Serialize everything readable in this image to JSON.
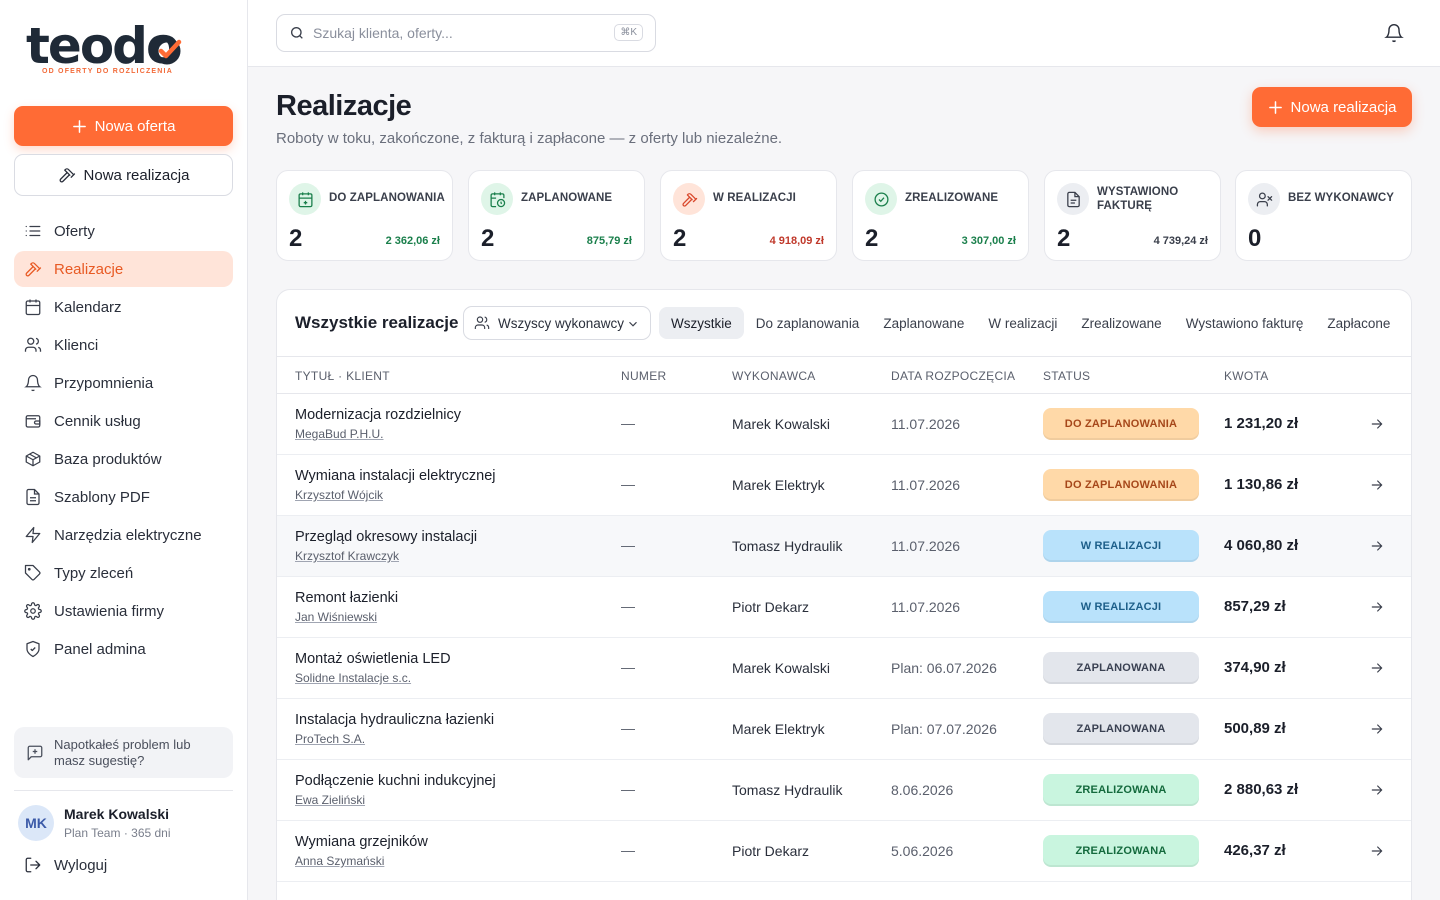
{
  "brand": {
    "name": "teodo",
    "tagline": "OD OFERTY DO ROZLICZENIA",
    "accent": "#ff6b35"
  },
  "sidebar": {
    "new_offer_label": "Nowa oferta",
    "new_realization_label": "Nowa realizacja",
    "items": [
      {
        "label": "Oferty",
        "icon": "list-icon"
      },
      {
        "label": "Realizacje",
        "icon": "hammer-icon",
        "active": true
      },
      {
        "label": "Kalendarz",
        "icon": "calendar-icon"
      },
      {
        "label": "Klienci",
        "icon": "users-icon"
      },
      {
        "label": "Przypomnienia",
        "icon": "bell-icon"
      },
      {
        "label": "Cennik usług",
        "icon": "wallet-icon"
      },
      {
        "label": "Baza produktów",
        "icon": "box-icon"
      },
      {
        "label": "Szablony PDF",
        "icon": "file-icon"
      },
      {
        "label": "Narzędzia elektryczne",
        "icon": "zap-icon"
      },
      {
        "label": "Typy zleceń",
        "icon": "tag-icon"
      },
      {
        "label": "Ustawienia firmy",
        "icon": "gear-icon"
      },
      {
        "label": "Panel admina",
        "icon": "shield-icon"
      }
    ],
    "feedback_label": "Napotkałeś problem lub masz sugestię?",
    "user": {
      "initials": "MK",
      "name": "Marek Kowalski",
      "plan": "Plan Team · 365 dni"
    },
    "logout_label": "Wyloguj"
  },
  "topbar": {
    "search_placeholder": "Szukaj klienta, oferty...",
    "shortcut": "⌘K"
  },
  "page": {
    "title": "Realizacje",
    "subtitle": "Roboty w toku, zakończone, z fakturą i zapłacone — z oferty lub niezależne.",
    "new_button": "Nowa realizacja"
  },
  "stats": [
    {
      "label": "DO ZAPLANOWANIA",
      "count": "2",
      "amount": "2 362,06 zł",
      "color": "#1a7f4b",
      "icon": "calendar-plus-icon"
    },
    {
      "label": "ZAPLANOWANE",
      "count": "2",
      "amount": "875,79 zł",
      "color": "#1a7f4b",
      "icon": "calendar-clock-icon"
    },
    {
      "label": "W REALIZACJI",
      "count": "2",
      "amount": "4 918,09 zł",
      "color": "#c0392b",
      "icon": "hammer-icon"
    },
    {
      "label": "ZREALIZOWANE",
      "count": "2",
      "amount": "3 307,00 zł",
      "color": "#1a7f4b",
      "icon": "check-circle-icon"
    },
    {
      "label": "WYSTAWIONO FAKTURĘ",
      "count": "2",
      "amount": "4 739,24 zł",
      "color": "#3a3f4b",
      "icon": "invoice-icon"
    },
    {
      "label": "BEZ WYKONAWCY",
      "count": "0",
      "amount": "",
      "color": "#3a3f4b",
      "icon": "user-x-icon"
    }
  ],
  "table": {
    "title": "Wszystkie realizacje",
    "executor_filter": "Wszyscy wykonawcy",
    "tabs": [
      "Wszystkie",
      "Do zaplanowania",
      "Zaplanowane",
      "W realizacji",
      "Zrealizowane",
      "Wystawiono fakturę",
      "Zapłacone"
    ],
    "columns": {
      "title": "TYTUŁ · KLIENT",
      "number": "NUMER",
      "executor": "WYKONAWCA",
      "start": "DATA ROZPOCZĘCIA",
      "status": "STATUS",
      "amount": "KWOTA"
    },
    "rows": [
      {
        "title": "Modernizacja rozdzielnicy",
        "client": "MegaBud P.H.U.",
        "number": "—",
        "executor": "Marek Kowalski",
        "date": "11.07.2026",
        "status": "DO ZAPLANOWANIA",
        "status_type": "plan",
        "amount": "1 231,20 zł"
      },
      {
        "title": "Wymiana instalacji elektrycznej",
        "client": "Krzysztof Wójcik",
        "number": "—",
        "executor": "Marek Elektryk",
        "date": "11.07.2026",
        "status": "DO ZAPLANOWANIA",
        "status_type": "plan",
        "amount": "1 130,86 zł"
      },
      {
        "title": "Przegląd okresowy instalacji",
        "client": "Krzysztof Krawczyk",
        "number": "—",
        "executor": "Tomasz Hydraulik",
        "date": "11.07.2026",
        "status": "W REALIZACJI",
        "status_type": "real",
        "amount": "4 060,80 zł",
        "hover": true
      },
      {
        "title": "Remont łazienki",
        "client": "Jan Wiśniewski",
        "number": "—",
        "executor": "Piotr Dekarz",
        "date": "11.07.2026",
        "status": "W REALIZACJI",
        "status_type": "real",
        "amount": "857,29 zł"
      },
      {
        "title": "Montaż oświetlenia LED",
        "client": "Solidne Instalacje s.c.",
        "number": "—",
        "executor": "Marek Kowalski",
        "date": "Plan: 06.07.2026",
        "status": "ZAPLANOWANA",
        "status_type": "zapl",
        "amount": "374,90 zł"
      },
      {
        "title": "Instalacja hydrauliczna łazienki",
        "client": "ProTech S.A.",
        "number": "—",
        "executor": "Marek Elektryk",
        "date": "Plan: 07.07.2026",
        "status": "ZAPLANOWANA",
        "status_type": "zapl",
        "amount": "500,89 zł"
      },
      {
        "title": "Podłączenie kuchni indukcyjnej",
        "client": "Ewa Zieliński",
        "number": "—",
        "executor": "Tomasz Hydraulik",
        "date": "8.06.2026",
        "status": "ZREALIZOWANA",
        "status_type": "done",
        "amount": "2 880,63 zł"
      },
      {
        "title": "Wymiana grzejników",
        "client": "Anna Szymański",
        "number": "—",
        "executor": "Piotr Dekarz",
        "date": "5.06.2026",
        "status": "ZREALIZOWANA",
        "status_type": "done",
        "amount": "426,37 zł"
      }
    ]
  }
}
